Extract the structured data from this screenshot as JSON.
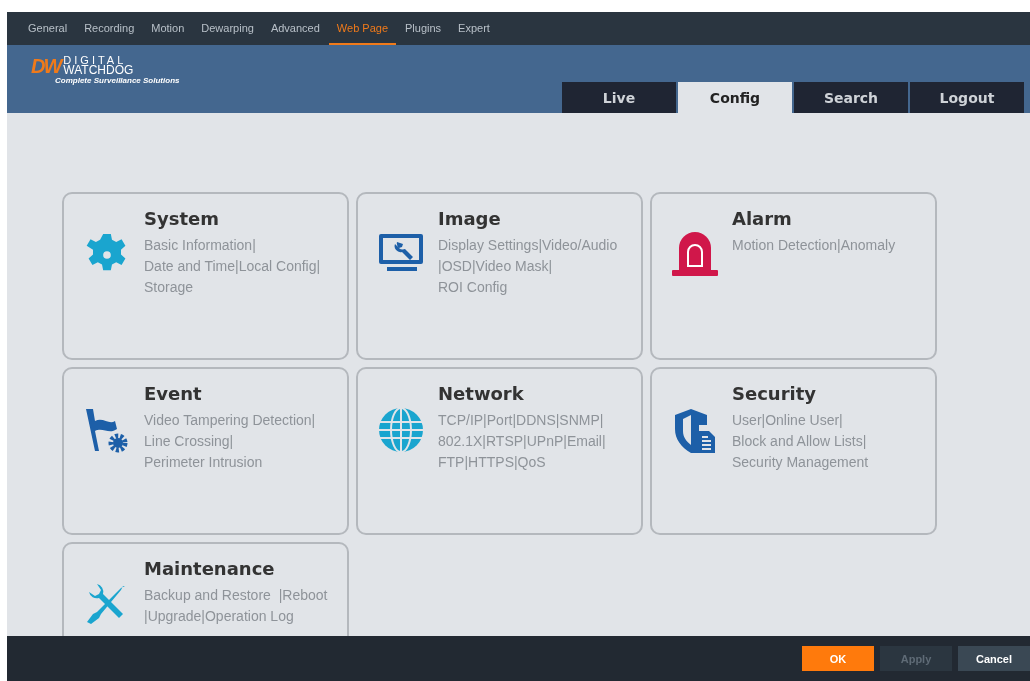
{
  "top_nav": [
    {
      "label": "General",
      "selected": false
    },
    {
      "label": "Recording",
      "selected": false
    },
    {
      "label": "Motion",
      "selected": false
    },
    {
      "label": "Dewarping",
      "selected": false
    },
    {
      "label": "Advanced",
      "selected": false
    },
    {
      "label": "Web Page",
      "selected": true
    },
    {
      "label": "Plugins",
      "selected": false
    },
    {
      "label": "Expert",
      "selected": false
    }
  ],
  "logo": {
    "mark": "DW",
    "line1": "DIGITAL",
    "line2": "WATCHDOG",
    "tagline": "Complete Surveillance Solutions"
  },
  "tabs": [
    {
      "label": "Live",
      "selected": false
    },
    {
      "label": "Config",
      "selected": true
    },
    {
      "label": "Search",
      "selected": false
    },
    {
      "label": "Logout",
      "selected": false
    }
  ],
  "cards": [
    {
      "title": "System",
      "links": [
        "Basic Information|",
        "Date and Time|Local Config|",
        "Storage"
      ]
    },
    {
      "title": "Image",
      "links": [
        "Display Settings|Video/Audio",
        "|OSD|Video Mask|",
        "ROI Config"
      ]
    },
    {
      "title": "Alarm",
      "links": [
        "Motion Detection|Anomaly"
      ]
    },
    {
      "title": "Event",
      "links": [
        "Video Tampering Detection|",
        "Line Crossing|",
        "Perimeter Intrusion"
      ]
    },
    {
      "title": "Network",
      "links": [
        "TCP/IP|Port|DDNS|SNMP|",
        "802.1X|RTSP|UPnP|Email|",
        "FTP|HTTPS|QoS"
      ]
    },
    {
      "title": "Security",
      "links": [
        "User|Online User|",
        "Block and Allow Lists|",
        "Security Management"
      ]
    },
    {
      "title": "Maintenance",
      "links": [
        "Backup and Restore  |Reboot",
        "|Upgrade|Operation Log"
      ]
    }
  ],
  "footer_buttons": [
    {
      "label": "OK",
      "kind": "primary",
      "disabled": false
    },
    {
      "label": "Apply",
      "kind": "default",
      "disabled": true
    },
    {
      "label": "Cancel",
      "kind": "default",
      "disabled": false
    }
  ]
}
